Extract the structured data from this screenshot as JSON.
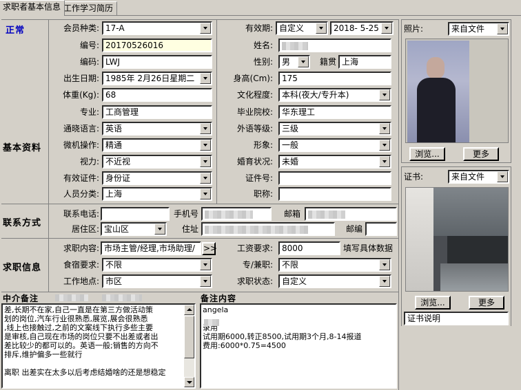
{
  "tabs": [
    "求职者基本信息",
    "工作学习简历"
  ],
  "status": "正常",
  "sections": {
    "basic": "基本资料",
    "contact": "联系方式",
    "job": "求职信息",
    "agent_note": "中介备注",
    "note": "备注内容"
  },
  "labels": {
    "member_type": "会员种类:",
    "validity": "有效期:",
    "number": "编号:",
    "name": "姓名:",
    "code": "编码:",
    "gender": "性别:",
    "native": "籍贯",
    "birth": "出生日期:",
    "height": "身高(Cm):",
    "weight": "体重(Kg):",
    "education": "文化程度:",
    "major": "专业:",
    "school": "毕业院校:",
    "language": "通晓语言:",
    "language_level": "外语等级:",
    "computer": "微机操作:",
    "appearance": "形象:",
    "vision": "视力:",
    "marriage": "婚育状况:",
    "id_doc": "有效证件:",
    "cert_no": "证件号:",
    "category": "人员分类:",
    "title": "职称:",
    "phone": "联系电话:",
    "mobile": "手机号",
    "email": "邮箱",
    "district": "居住区:",
    "address": "住址",
    "postcode": "邮编",
    "job_content": "求职内容:",
    "salary": "工资要求:",
    "salary_hint": "填写具体数据",
    "board": "食宿要求:",
    "fulltime": "专/兼职:",
    "location": "工作地点:",
    "job_status": "求职状态:"
  },
  "values": {
    "member_type": "17-A",
    "validity_mode": "自定义",
    "validity_date": "2018- 5-25",
    "number": "20170526016",
    "code": "LWJ",
    "gender": "男",
    "native": "上海",
    "birth": "1985年 2月26日星期二",
    "height": "175",
    "weight": "68",
    "education": "本科(夜大/专升本)",
    "major": "工商管理",
    "school": "华东理工",
    "language": "英语",
    "language_level": "三级",
    "computer": "精通",
    "appearance": "一般",
    "vision": "不近视",
    "marriage": "未婚",
    "id_doc": "身份证",
    "category": "上海",
    "district": "宝山区",
    "job_content": "市场主管/经理,市场助理/",
    "salary": "8000",
    "board": "不限",
    "fulltime": "不限",
    "location": "市区",
    "job_status": "自定义"
  },
  "photo_panel": {
    "label": "照片:",
    "source": "来自文件",
    "browse": "浏览...",
    "more": "更多"
  },
  "cert_panel": {
    "label": "证书:",
    "source": "来自文件",
    "browse": "浏览...",
    "more": "更多",
    "desc": "证书说明"
  },
  "more_button": ">>",
  "agent_note_lines": [
    "差,长期不在家,自己一直是在第三方做活动策",
    "划的岗位,汽车行业很熟悉,展览,展会很熟悉",
    ",线上也接触过,之前的文案线下执行多些主要",
    "是审核,自己现在市场的岗位只要不出差或者出",
    "差比较少的都可以的。英语一般;销售的方向不",
    "排斥,维护偏多一些就行",
    "",
    "离职 出差实在太多以后考虑结婚啥的还是想稳定"
  ],
  "note_lines": [
    "angela",
    "",
    "录用",
    "试用期6000,转正8500,试用期3个月,8-14报道",
    "费用:6000*0.75=4500"
  ]
}
